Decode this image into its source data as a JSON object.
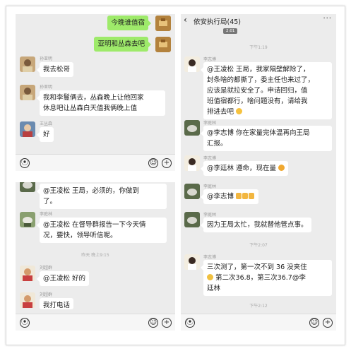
{
  "top_left": {
    "messages": [
      {
        "text": "今晚谁值宿"
      },
      {
        "text": "亚明和丛森去吧"
      },
      {
        "name": "孙亚明",
        "text": "我去松哥"
      },
      {
        "name": "孙亚明",
        "line1": "我和李鬘俩去，丛森晚上让他回家",
        "line2": "休息吧让丛森白天值我俩晚上值"
      },
      {
        "name": "王丛森",
        "text": "好"
      }
    ]
  },
  "bottom_left": {
    "messages": [
      {
        "line1": "@王凌松  王局，必须的，你做到",
        "line2": "了。"
      },
      {
        "name": "李庭林",
        "line1": "@王凌松  在督导群报告一下今天情",
        "line2": "况，要快，领导听信呢。"
      },
      {
        "name": "刘超群",
        "text": "@王凌松  好的"
      },
      {
        "name": "刘超群",
        "text": "我打电话"
      }
    ],
    "timestamp": "昨天 晚上9:15"
  },
  "right": {
    "title": "依安执行局(45)",
    "back_icon": "chevron-left-icon",
    "more_icon": "ellipsis-icon",
    "stub": "2:01",
    "timestamps": [
      "下午1:19",
      "下午2:07",
      "下午2:12"
    ],
    "messages": [
      {
        "name": "李志博",
        "line1": "@王凌松  王局，我家隔壁解除了，",
        "line2": "封条啥的都撕了，委主任也来过了，",
        "line3": "应该是就拉安全了。申请回归，值",
        "line4": "班值宿都行，啥问题没有，请给我",
        "line5": "排进去吧"
      },
      {
        "name": "李庭林",
        "line1": "@李志博  你在家量完体温再向王局",
        "line2": "汇报。"
      },
      {
        "name": "李志博",
        "text": "@李廷林  遵命，现在量"
      },
      {
        "name": "李庭林",
        "text": "@李志博"
      },
      {
        "name": "李庭林",
        "text": "因为王局太忙，我就替他管点事。"
      },
      {
        "name": "李志博",
        "line1": "三次测了，第一次不到 36 没夹住",
        "line2": "第二次36.8，第三次36.7@李",
        "line3": "廷林"
      }
    ]
  },
  "colors": {
    "green_bubble": "#9eea6a",
    "chat_bg": "#ececec"
  },
  "icons": {
    "voice": "voice-icon",
    "emoji": "emoji-icon",
    "plus": "plus-icon"
  }
}
